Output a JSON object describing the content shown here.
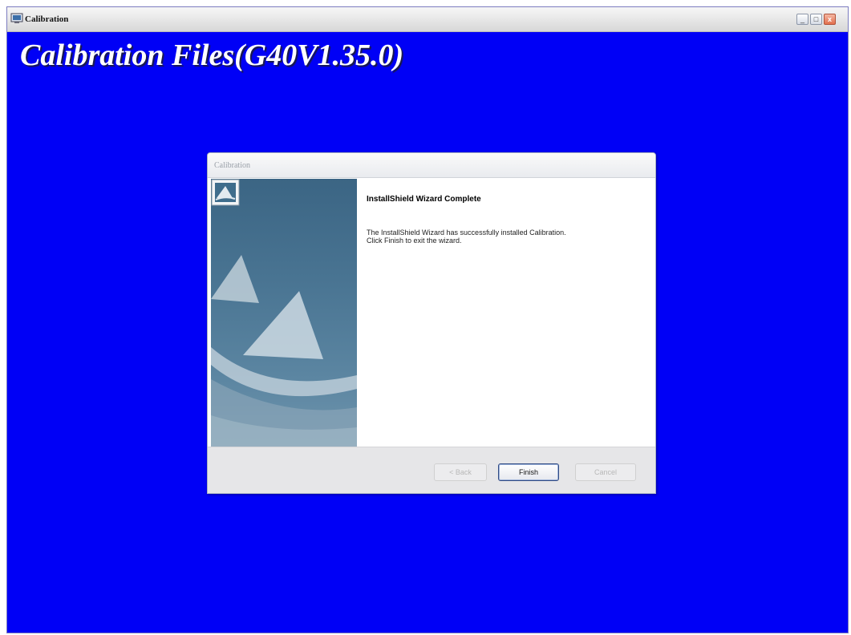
{
  "window": {
    "title": "Calibration",
    "controls": {
      "minimize": "_",
      "maximize": "□",
      "close": "x"
    }
  },
  "page": {
    "heading": "Calibration Files(G40V1.35.0)",
    "background_color": "#0000f6"
  },
  "dialog": {
    "title": "Calibration",
    "heading": "InstallShield Wizard Complete",
    "body_line1": "The InstallShield Wizard has successfully installed Calibration.",
    "body_line2": "Click Finish to exit the wizard.",
    "buttons": {
      "back": "< Back",
      "finish": "Finish",
      "cancel": "Cancel"
    },
    "side_panel_color": "#4a7593"
  },
  "icons": {
    "app": "app-icon",
    "wizard": "installshield-icon"
  }
}
